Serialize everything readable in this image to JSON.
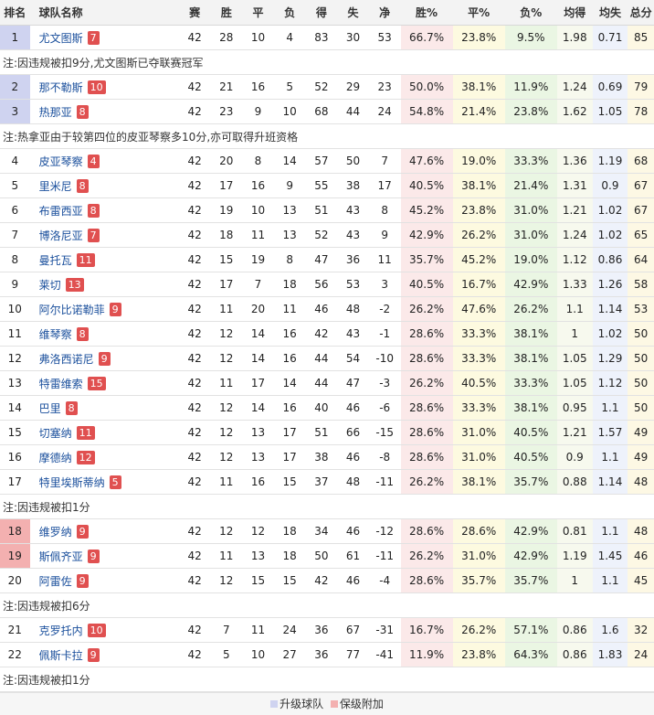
{
  "headers": [
    "排名",
    "球队名称",
    "赛",
    "胜",
    "平",
    "负",
    "得",
    "失",
    "净",
    "胜%",
    "平%",
    "负%",
    "均得",
    "均失",
    "总分"
  ],
  "blocks": [
    {
      "type": "row",
      "zone": "promo",
      "rank": "1",
      "team": "尤文图斯",
      "badge": "7",
      "p": "42",
      "w": "28",
      "d": "10",
      "l": "4",
      "gf": "83",
      "ga": "30",
      "gd": "53",
      "wp": "66.7%",
      "dp": "23.8%",
      "lp": "9.5%",
      "af": "1.98",
      "aa": "0.71",
      "pts": "85"
    },
    {
      "type": "note",
      "text": "注:因违规被扣9分,尤文图斯已夺联赛冠军"
    },
    {
      "type": "row",
      "zone": "promo",
      "rank": "2",
      "team": "那不勒斯",
      "badge": "10",
      "p": "42",
      "w": "21",
      "d": "16",
      "l": "5",
      "gf": "52",
      "ga": "29",
      "gd": "23",
      "wp": "50.0%",
      "dp": "38.1%",
      "lp": "11.9%",
      "af": "1.24",
      "aa": "0.69",
      "pts": "79"
    },
    {
      "type": "row",
      "zone": "promo",
      "rank": "3",
      "team": "热那亚",
      "badge": "8",
      "p": "42",
      "w": "23",
      "d": "9",
      "l": "10",
      "gf": "68",
      "ga": "44",
      "gd": "24",
      "wp": "54.8%",
      "dp": "21.4%",
      "lp": "23.8%",
      "af": "1.62",
      "aa": "1.05",
      "pts": "78"
    },
    {
      "type": "note",
      "text": "注:热拿亚由于较第四位的皮亚琴察多10分,亦可取得升班资格"
    },
    {
      "type": "row",
      "zone": "",
      "rank": "4",
      "team": "皮亚琴察",
      "badge": "4",
      "p": "42",
      "w": "20",
      "d": "8",
      "l": "14",
      "gf": "57",
      "ga": "50",
      "gd": "7",
      "wp": "47.6%",
      "dp": "19.0%",
      "lp": "33.3%",
      "af": "1.36",
      "aa": "1.19",
      "pts": "68"
    },
    {
      "type": "row",
      "zone": "",
      "rank": "5",
      "team": "里米尼",
      "badge": "8",
      "p": "42",
      "w": "17",
      "d": "16",
      "l": "9",
      "gf": "55",
      "ga": "38",
      "gd": "17",
      "wp": "40.5%",
      "dp": "38.1%",
      "lp": "21.4%",
      "af": "1.31",
      "aa": "0.9",
      "pts": "67"
    },
    {
      "type": "row",
      "zone": "",
      "rank": "6",
      "team": "布雷西亚",
      "badge": "8",
      "p": "42",
      "w": "19",
      "d": "10",
      "l": "13",
      "gf": "51",
      "ga": "43",
      "gd": "8",
      "wp": "45.2%",
      "dp": "23.8%",
      "lp": "31.0%",
      "af": "1.21",
      "aa": "1.02",
      "pts": "67"
    },
    {
      "type": "row",
      "zone": "",
      "rank": "7",
      "team": "博洛尼亚",
      "badge": "7",
      "p": "42",
      "w": "18",
      "d": "11",
      "l": "13",
      "gf": "52",
      "ga": "43",
      "gd": "9",
      "wp": "42.9%",
      "dp": "26.2%",
      "lp": "31.0%",
      "af": "1.24",
      "aa": "1.02",
      "pts": "65"
    },
    {
      "type": "row",
      "zone": "",
      "rank": "8",
      "team": "曼托瓦",
      "badge": "11",
      "p": "42",
      "w": "15",
      "d": "19",
      "l": "8",
      "gf": "47",
      "ga": "36",
      "gd": "11",
      "wp": "35.7%",
      "dp": "45.2%",
      "lp": "19.0%",
      "af": "1.12",
      "aa": "0.86",
      "pts": "64"
    },
    {
      "type": "row",
      "zone": "",
      "rank": "9",
      "team": "莱切",
      "badge": "13",
      "p": "42",
      "w": "17",
      "d": "7",
      "l": "18",
      "gf": "56",
      "ga": "53",
      "gd": "3",
      "wp": "40.5%",
      "dp": "16.7%",
      "lp": "42.9%",
      "af": "1.33",
      "aa": "1.26",
      "pts": "58"
    },
    {
      "type": "row",
      "zone": "",
      "rank": "10",
      "team": "阿尔比诺勒菲",
      "badge": "9",
      "p": "42",
      "w": "11",
      "d": "20",
      "l": "11",
      "gf": "46",
      "ga": "48",
      "gd": "-2",
      "wp": "26.2%",
      "dp": "47.6%",
      "lp": "26.2%",
      "af": "1.1",
      "aa": "1.14",
      "pts": "53"
    },
    {
      "type": "row",
      "zone": "",
      "rank": "11",
      "team": "维琴察",
      "badge": "8",
      "p": "42",
      "w": "12",
      "d": "14",
      "l": "16",
      "gf": "42",
      "ga": "43",
      "gd": "-1",
      "wp": "28.6%",
      "dp": "33.3%",
      "lp": "38.1%",
      "af": "1",
      "aa": "1.02",
      "pts": "50"
    },
    {
      "type": "row",
      "zone": "",
      "rank": "12",
      "team": "弗洛西诺尼",
      "badge": "9",
      "p": "42",
      "w": "12",
      "d": "14",
      "l": "16",
      "gf": "44",
      "ga": "54",
      "gd": "-10",
      "wp": "28.6%",
      "dp": "33.3%",
      "lp": "38.1%",
      "af": "1.05",
      "aa": "1.29",
      "pts": "50"
    },
    {
      "type": "row",
      "zone": "",
      "rank": "13",
      "team": "特雷维索",
      "badge": "15",
      "p": "42",
      "w": "11",
      "d": "17",
      "l": "14",
      "gf": "44",
      "ga": "47",
      "gd": "-3",
      "wp": "26.2%",
      "dp": "40.5%",
      "lp": "33.3%",
      "af": "1.05",
      "aa": "1.12",
      "pts": "50"
    },
    {
      "type": "row",
      "zone": "",
      "rank": "14",
      "team": "巴里",
      "badge": "8",
      "p": "42",
      "w": "12",
      "d": "14",
      "l": "16",
      "gf": "40",
      "ga": "46",
      "gd": "-6",
      "wp": "28.6%",
      "dp": "33.3%",
      "lp": "38.1%",
      "af": "0.95",
      "aa": "1.1",
      "pts": "50"
    },
    {
      "type": "row",
      "zone": "",
      "rank": "15",
      "team": "切塞纳",
      "badge": "11",
      "p": "42",
      "w": "12",
      "d": "13",
      "l": "17",
      "gf": "51",
      "ga": "66",
      "gd": "-15",
      "wp": "28.6%",
      "dp": "31.0%",
      "lp": "40.5%",
      "af": "1.21",
      "aa": "1.57",
      "pts": "49"
    },
    {
      "type": "row",
      "zone": "",
      "rank": "16",
      "team": "摩德纳",
      "badge": "12",
      "p": "42",
      "w": "12",
      "d": "13",
      "l": "17",
      "gf": "38",
      "ga": "46",
      "gd": "-8",
      "wp": "28.6%",
      "dp": "31.0%",
      "lp": "40.5%",
      "af": "0.9",
      "aa": "1.1",
      "pts": "49"
    },
    {
      "type": "row",
      "zone": "",
      "rank": "17",
      "team": "特里埃斯蒂纳",
      "badge": "5",
      "p": "42",
      "w": "11",
      "d": "16",
      "l": "15",
      "gf": "37",
      "ga": "48",
      "gd": "-11",
      "wp": "26.2%",
      "dp": "38.1%",
      "lp": "35.7%",
      "af": "0.88",
      "aa": "1.14",
      "pts": "48"
    },
    {
      "type": "note",
      "text": "注:因违规被扣1分"
    },
    {
      "type": "row",
      "zone": "rel",
      "rank": "18",
      "team": "维罗纳",
      "badge": "9",
      "p": "42",
      "w": "12",
      "d": "12",
      "l": "18",
      "gf": "34",
      "ga": "46",
      "gd": "-12",
      "wp": "28.6%",
      "dp": "28.6%",
      "lp": "42.9%",
      "af": "0.81",
      "aa": "1.1",
      "pts": "48"
    },
    {
      "type": "row",
      "zone": "rel",
      "rank": "19",
      "team": "斯佩齐亚",
      "badge": "9",
      "p": "42",
      "w": "11",
      "d": "13",
      "l": "18",
      "gf": "50",
      "ga": "61",
      "gd": "-11",
      "wp": "26.2%",
      "dp": "31.0%",
      "lp": "42.9%",
      "af": "1.19",
      "aa": "1.45",
      "pts": "46"
    },
    {
      "type": "row",
      "zone": "",
      "rank": "20",
      "team": "阿雷佐",
      "badge": "9",
      "p": "42",
      "w": "12",
      "d": "15",
      "l": "15",
      "gf": "42",
      "ga": "46",
      "gd": "-4",
      "wp": "28.6%",
      "dp": "35.7%",
      "lp": "35.7%",
      "af": "1",
      "aa": "1.1",
      "pts": "45"
    },
    {
      "type": "note",
      "text": "注:因违规被扣6分"
    },
    {
      "type": "row",
      "zone": "",
      "rank": "21",
      "team": "克罗托内",
      "badge": "10",
      "p": "42",
      "w": "7",
      "d": "11",
      "l": "24",
      "gf": "36",
      "ga": "67",
      "gd": "-31",
      "wp": "16.7%",
      "dp": "26.2%",
      "lp": "57.1%",
      "af": "0.86",
      "aa": "1.6",
      "pts": "32"
    },
    {
      "type": "row",
      "zone": "",
      "rank": "22",
      "team": "佩斯卡拉",
      "badge": "9",
      "p": "42",
      "w": "5",
      "d": "10",
      "l": "27",
      "gf": "36",
      "ga": "77",
      "gd": "-41",
      "wp": "11.9%",
      "dp": "23.8%",
      "lp": "64.3%",
      "af": "0.86",
      "aa": "1.83",
      "pts": "24"
    },
    {
      "type": "note",
      "text": "注:因违规被扣1分"
    }
  ],
  "legend": {
    "promo_label": "升级球队",
    "rel_label": "保级附加",
    "promo_color": "#cfd3f0",
    "rel_color": "#f3b0b0"
  }
}
